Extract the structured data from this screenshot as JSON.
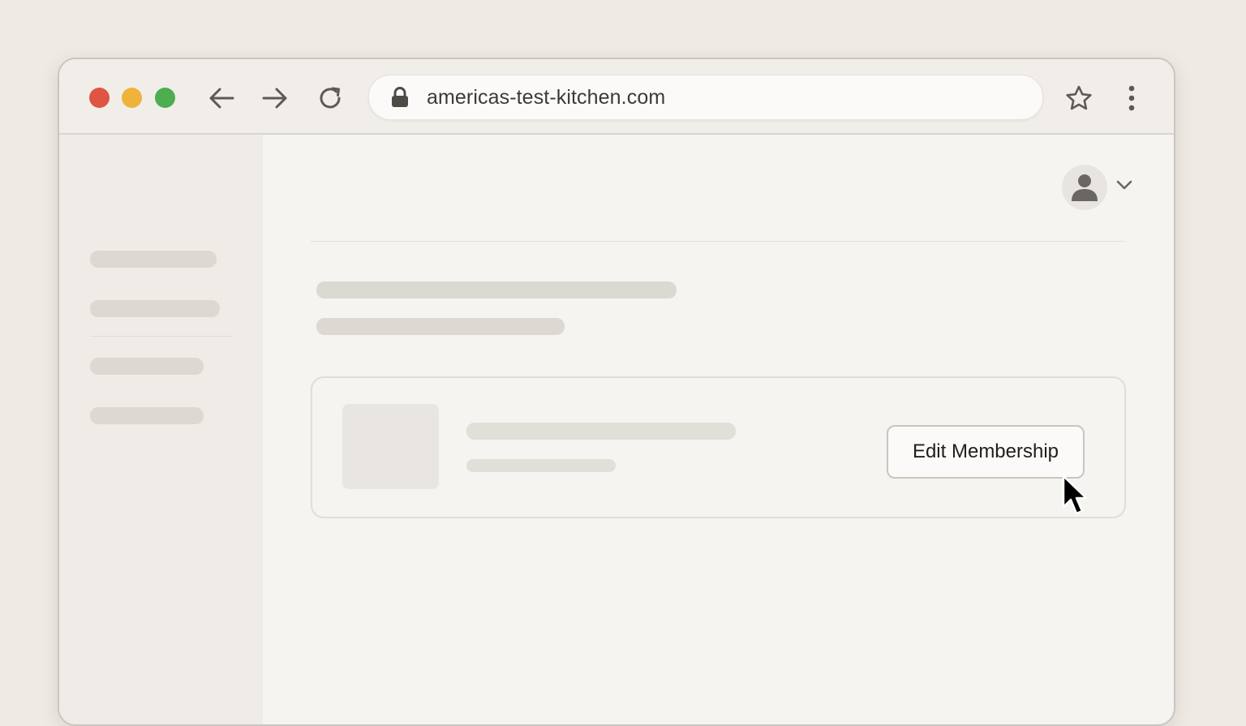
{
  "browser": {
    "url": "americas-test-kitchen.com",
    "traffic_lights": {
      "close": "#e05443",
      "minimize": "#efb33c",
      "maximize": "#4cae4f"
    },
    "icons": [
      "back-arrow-icon",
      "forward-arrow-icon",
      "reload-icon",
      "lock-icon",
      "star-icon",
      "kebab-menu-icon"
    ]
  },
  "page": {
    "header": {
      "avatar_icon": "user-icon",
      "dropdown_icon": "chevron-down-icon"
    },
    "membership_card": {
      "edit_button_label": "Edit Membership"
    }
  },
  "colors": {
    "background": "#efeae4",
    "skeleton": "#dcd8d2"
  }
}
